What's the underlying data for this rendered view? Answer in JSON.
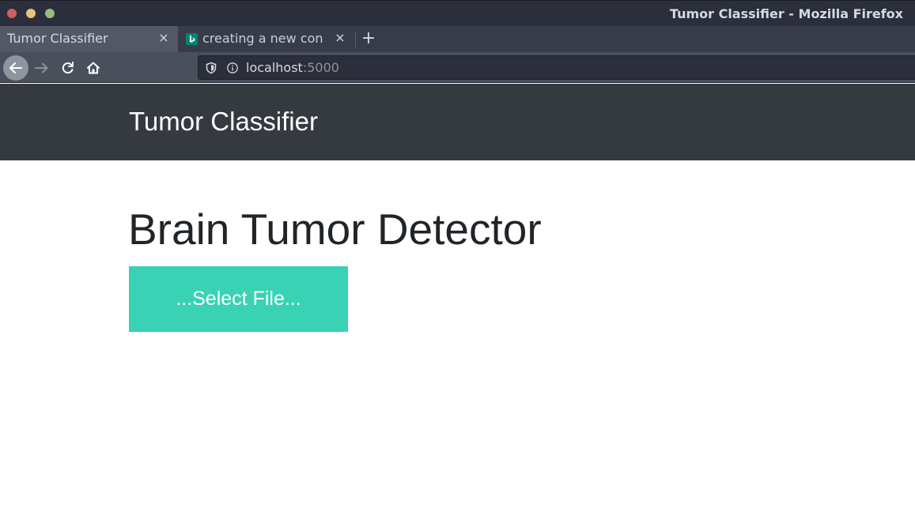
{
  "window": {
    "title": "Tumor Classifier - Mozilla Firefox"
  },
  "tabs": [
    {
      "label": "Tumor Classifier",
      "active": true,
      "close": "×"
    },
    {
      "label": "creating a new con",
      "active": false,
      "close": "×",
      "icon": "bing-icon"
    }
  ],
  "new_tab_label": "+",
  "nav": {
    "url_host": "localhost",
    "url_port": ":5000",
    "icons": [
      "back-arrow-icon",
      "forward-arrow-icon",
      "reload-icon",
      "home-icon",
      "shield-icon",
      "info-icon"
    ]
  },
  "page": {
    "brand": "Tumor Classifier",
    "heading": "Brain Tumor Detector",
    "select_button": "...Select File...",
    "colors": {
      "header_bg": "#343a40",
      "button_bg": "#39d2b4"
    }
  }
}
